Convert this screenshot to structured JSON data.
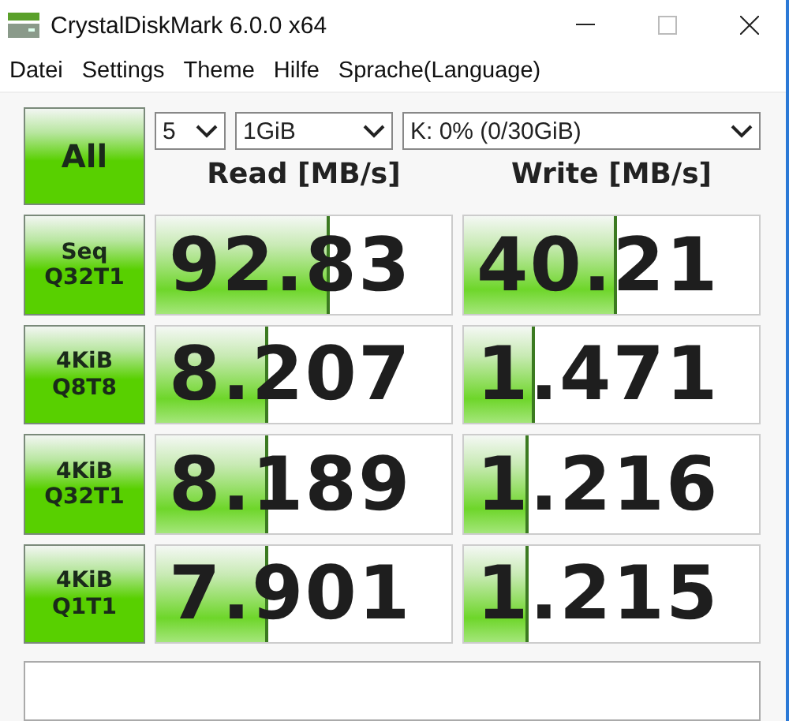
{
  "window": {
    "title": "CrystalDiskMark 6.0.0 x64"
  },
  "menu": [
    "Datei",
    "Settings",
    "Theme",
    "Hilfe",
    "Sprache(Language)"
  ],
  "all_button": "All",
  "controls": {
    "count": "5",
    "size": "1GiB",
    "drive": "K: 0% (0/30GiB)"
  },
  "columns": [
    "Read [MB/s]",
    "Write [MB/s]"
  ],
  "rows": [
    {
      "label": [
        "Seq",
        "Q32T1"
      ],
      "read": {
        "value": "92.83",
        "level": 0.59
      },
      "write": {
        "value": "40.21",
        "level": 0.52
      }
    },
    {
      "label": [
        "4KiB",
        "Q8T8"
      ],
      "read": {
        "value": "8.207",
        "level": 0.38
      },
      "write": {
        "value": "1.471",
        "level": 0.24
      }
    },
    {
      "label": [
        "4KiB",
        "Q32T1"
      ],
      "read": {
        "value": "8.189",
        "level": 0.38
      },
      "write": {
        "value": "1.216",
        "level": 0.22
      }
    },
    {
      "label": [
        "4KiB",
        "Q1T1"
      ],
      "read": {
        "value": "7.901",
        "level": 0.38
      },
      "write": {
        "value": "1.215",
        "level": 0.22
      }
    }
  ]
}
